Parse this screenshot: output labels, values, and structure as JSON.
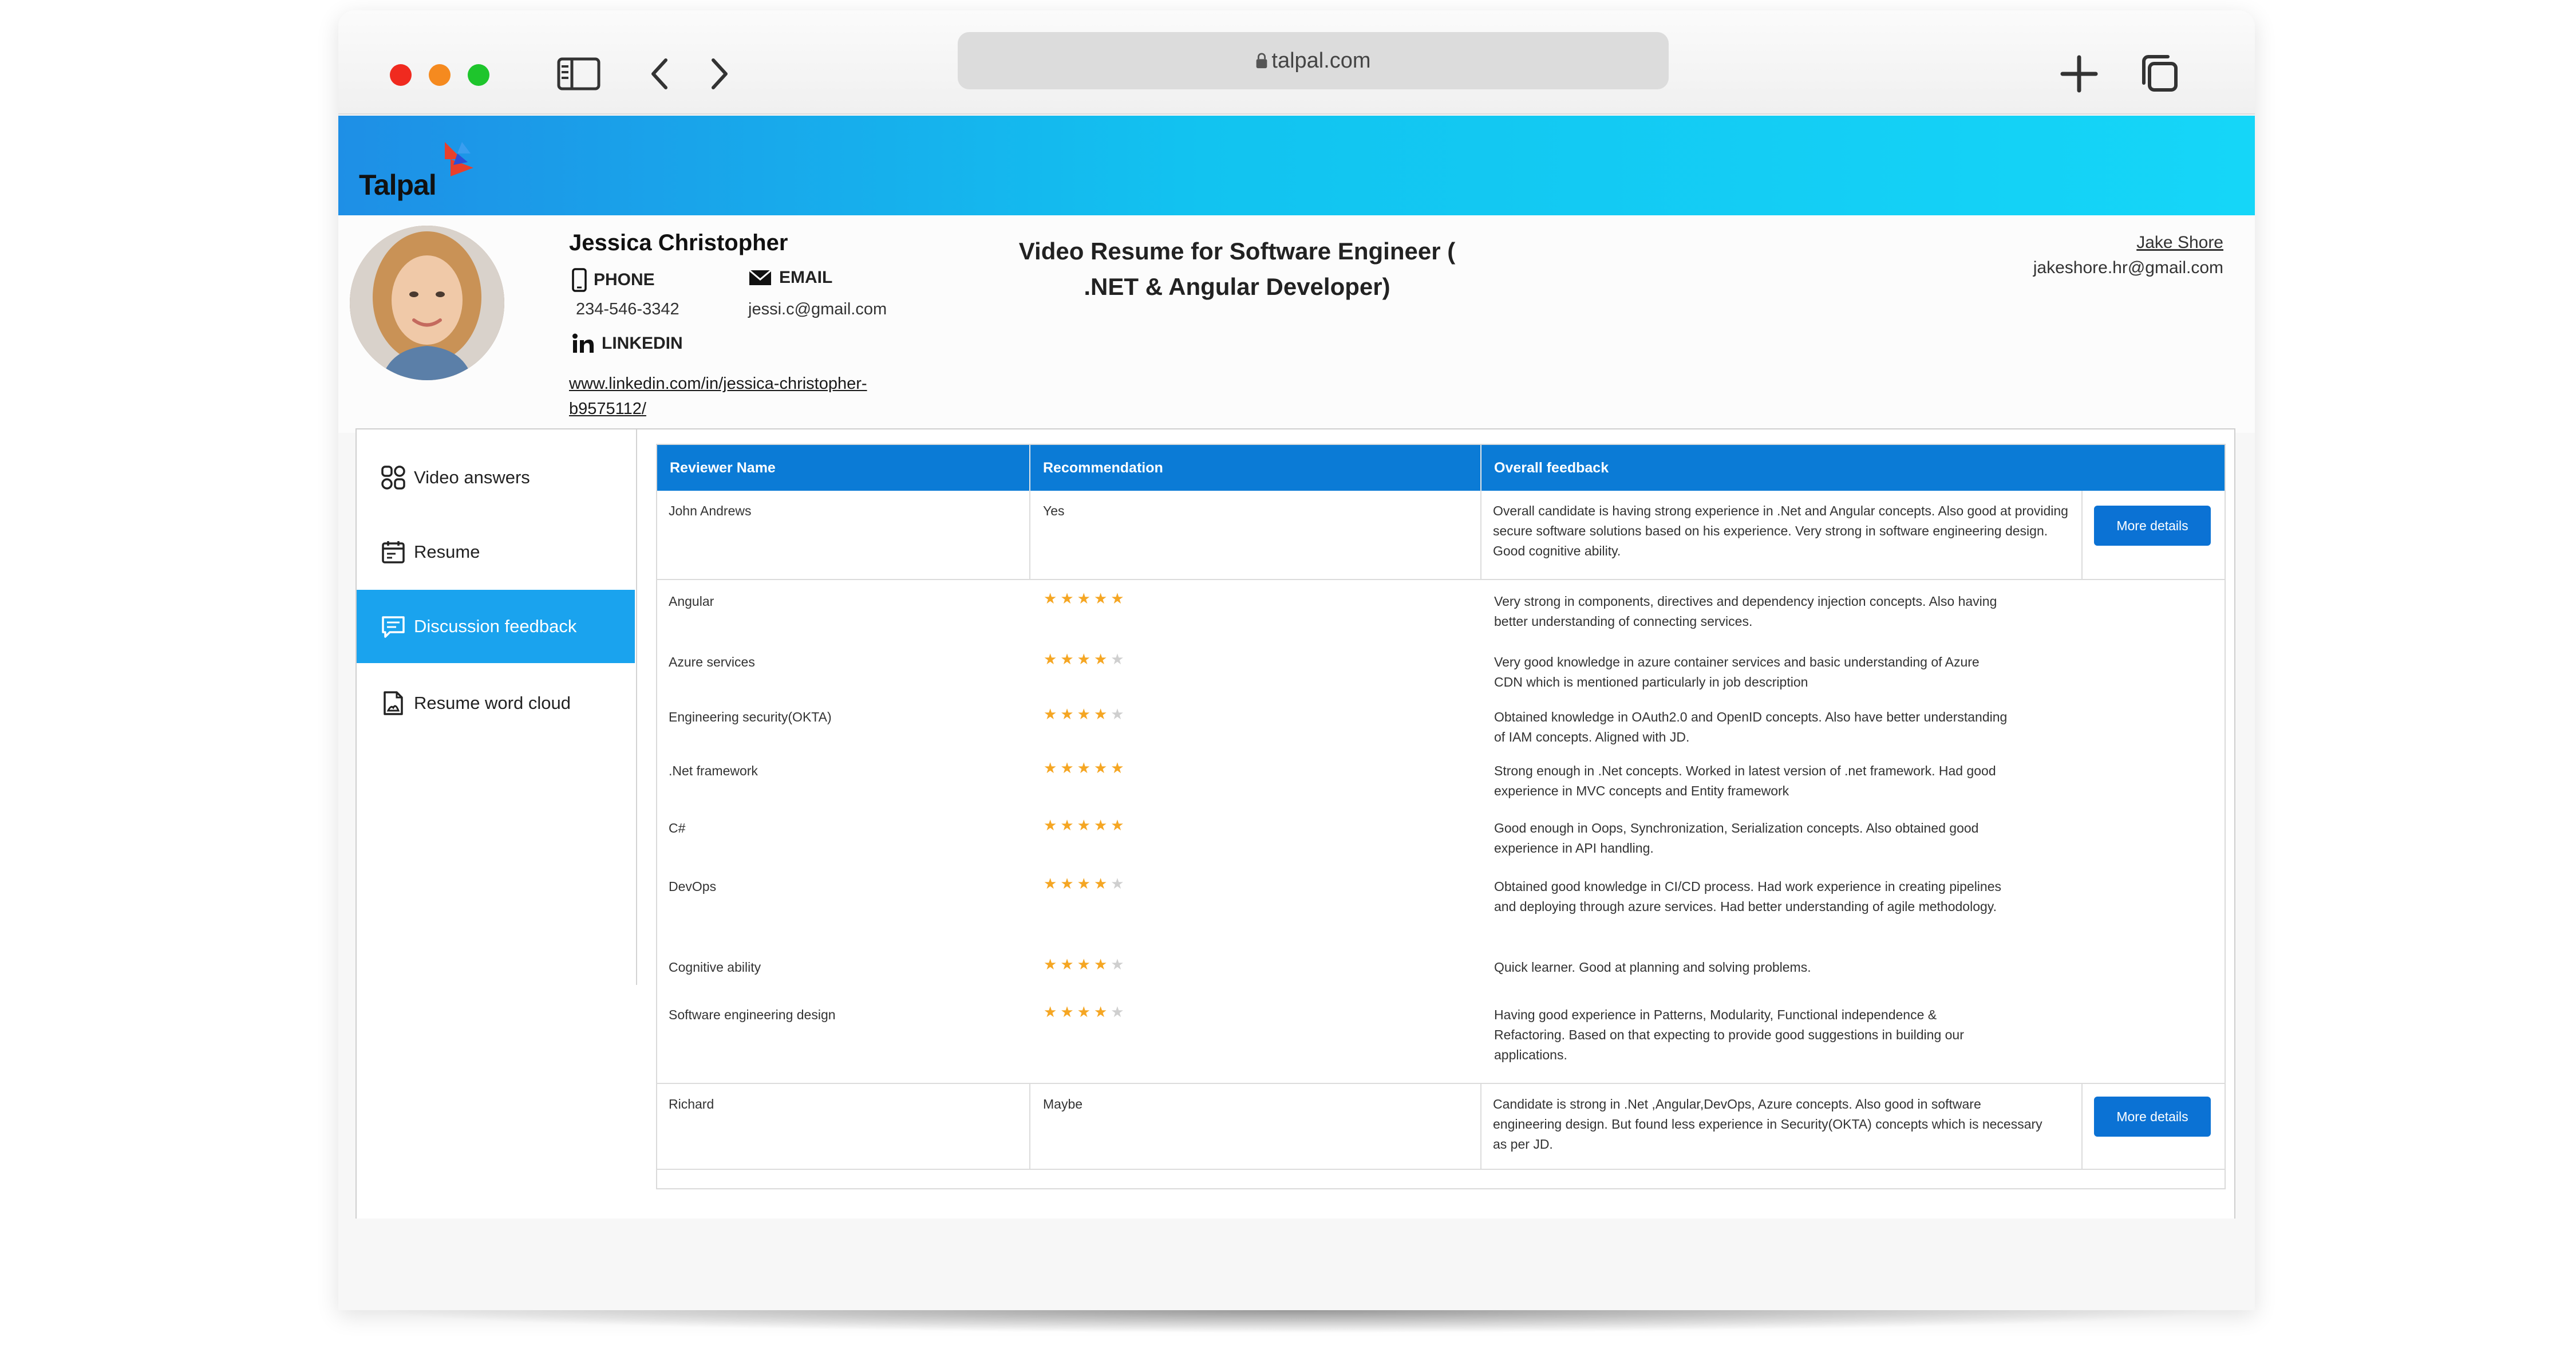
{
  "browser": {
    "url": "talpal.com"
  },
  "app": {
    "logo_text": "Talpal"
  },
  "candidate": {
    "name": "Jessica Christopher",
    "phone_label": "PHONE",
    "phone": "234-546-3342",
    "email_label": "EMAIL",
    "email": "jessi.c@gmail.com",
    "linkedin_label": "LINKEDIN",
    "linkedin_url": "www.linkedin.com/in/jessica-christopher-b9575112/"
  },
  "job_title": "Video Resume for Software Engineer ( .NET & Angular Developer)",
  "recruiter": {
    "name": "Jake Shore",
    "email": "jakeshore.hr@gmail.com"
  },
  "sidenav": {
    "items": [
      {
        "label": "Video answers",
        "icon": "grid-icon"
      },
      {
        "label": "Resume",
        "icon": "calendar-icon"
      },
      {
        "label": "Discussion feedback",
        "icon": "chat-icon",
        "active": true
      },
      {
        "label": "Resume word cloud",
        "icon": "document-icon"
      }
    ]
  },
  "table": {
    "headers": [
      "Reviewer Name",
      "Recommendation",
      "Overall feedback"
    ],
    "reviewers": [
      {
        "name": "John Andrews",
        "recommendation": "Yes",
        "feedback": "Overall candidate is having strong experience in .Net and Angular concepts. Also good at providing secure software solutions based on his experience. Very strong in software engineering design. Good cognitive ability.",
        "button": "More details"
      },
      {
        "name": "Richard",
        "recommendation": "Maybe",
        "feedback": "Candidate is strong in .Net ,Angular,DevOps, Azure concepts. Also good in software engineering design. But found less experience in Security(OKTA) concepts which is necessary as per JD.",
        "button": "More details"
      }
    ],
    "skills": [
      {
        "skill": "Angular",
        "rating": 5,
        "comment": "Very strong in components, directives and dependency injection concepts. Also having better understanding of connecting services."
      },
      {
        "skill": "Azure services",
        "rating": 4,
        "comment": "Very good knowledge in azure container services and basic understanding of Azure CDN which is mentioned particularly in job description"
      },
      {
        "skill": "Engineering security(OKTA)",
        "rating": 4,
        "comment": "Obtained knowledge in OAuth2.0 and OpenID concepts. Also have better understanding of IAM concepts. Aligned with JD."
      },
      {
        "skill": ".Net framework",
        "rating": 5,
        "comment": "Strong enough in .Net concepts. Worked in latest version of .net framework. Had good experience in MVC concepts and Entity framework"
      },
      {
        "skill": "C#",
        "rating": 5,
        "comment": "Good enough in Oops, Synchronization, Serialization concepts. Also obtained good experience in API handling."
      },
      {
        "skill": "DevOps",
        "rating": 4,
        "comment": "Obtained good knowledge in CI/CD process. Had work experience in creating pipelines and deploying through azure services. Had better understanding of agile methodology."
      },
      {
        "skill": "Cognitive ability",
        "rating": 4,
        "comment": "Quick learner. Good at planning and solving problems."
      },
      {
        "skill": "Software engineering design",
        "rating": 4,
        "comment": "Having good experience in Patterns, Modularity, Functional independence & Refactoring. Based on that expecting to provide good suggestions in building our applications."
      }
    ]
  },
  "colors": {
    "header_gradient_start": "#1e8fe6",
    "header_gradient_end": "#15d6f8",
    "table_header": "#0b7bd6",
    "active_nav": "#1aa3ee",
    "button": "#0b72d4",
    "star": "#f5a623"
  }
}
